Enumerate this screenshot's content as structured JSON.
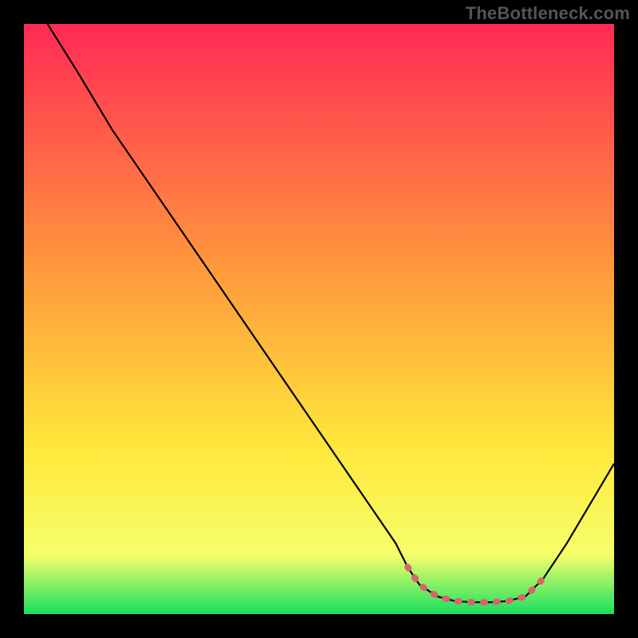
{
  "watermark": "TheBottleneck.com",
  "chart_data": {
    "type": "line",
    "title": "",
    "xlabel": "",
    "ylabel": "",
    "xlim": [
      0,
      100
    ],
    "ylim": [
      0,
      100
    ],
    "grid": false,
    "legend": false,
    "curve": {
      "name": "bottleneck-curve",
      "color": "#000000",
      "points": [
        {
          "x": 4,
          "y": 100
        },
        {
          "x": 9,
          "y": 92
        },
        {
          "x": 15,
          "y": 82
        },
        {
          "x": 63,
          "y": 12
        },
        {
          "x": 65,
          "y": 8
        },
        {
          "x": 67,
          "y": 5
        },
        {
          "x": 70,
          "y": 3
        },
        {
          "x": 73,
          "y": 2.2
        },
        {
          "x": 76,
          "y": 2
        },
        {
          "x": 79,
          "y": 2
        },
        {
          "x": 82,
          "y": 2.2
        },
        {
          "x": 85,
          "y": 3
        },
        {
          "x": 88,
          "y": 6
        },
        {
          "x": 92,
          "y": 12
        },
        {
          "x": 100,
          "y": 25.5
        }
      ]
    },
    "highlight": {
      "name": "optimal-range",
      "color": "#d9636e",
      "points": [
        {
          "x": 65,
          "y": 8
        },
        {
          "x": 67,
          "y": 5
        },
        {
          "x": 70,
          "y": 3
        },
        {
          "x": 73,
          "y": 2.2
        },
        {
          "x": 76,
          "y": 2
        },
        {
          "x": 79,
          "y": 2
        },
        {
          "x": 82,
          "y": 2.2
        },
        {
          "x": 85,
          "y": 3
        },
        {
          "x": 88,
          "y": 6
        }
      ]
    },
    "background_gradient": {
      "top": "#ff2a55",
      "mid1": "#ff9a3c",
      "mid2": "#ffe83c",
      "mid3": "#f6ff6a",
      "bottom": "#17e060"
    }
  }
}
